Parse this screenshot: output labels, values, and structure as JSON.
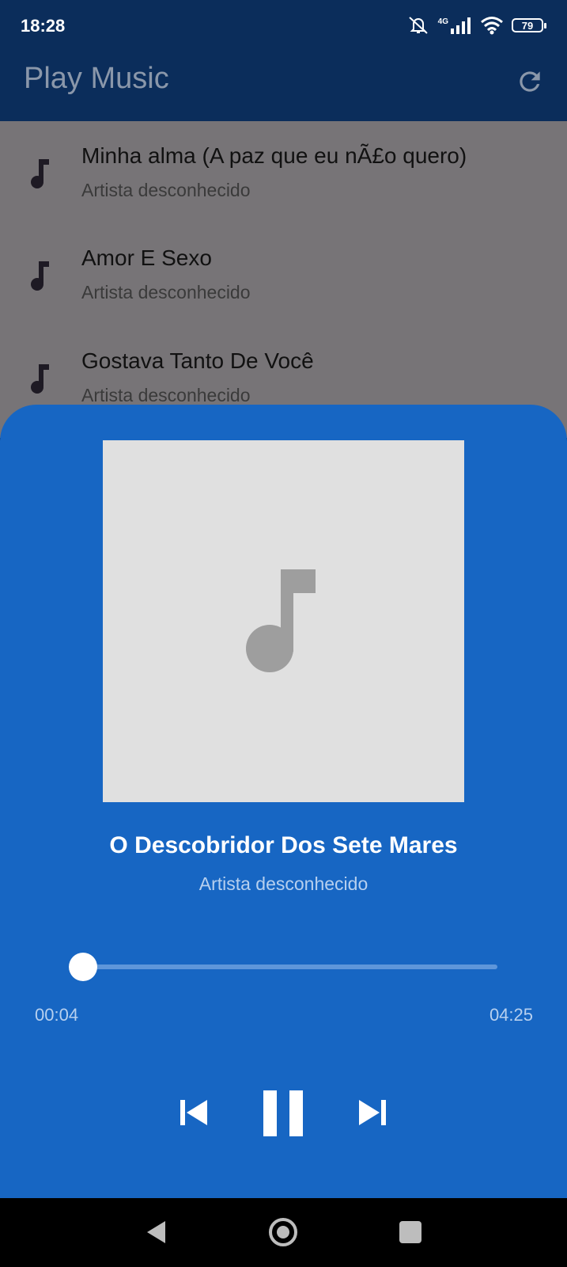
{
  "status_bar": {
    "time": "18:28",
    "network": "4G",
    "battery": "79",
    "icons": [
      "mute-icon",
      "signal-icon",
      "wifi-icon",
      "battery-icon"
    ]
  },
  "app_bar": {
    "title": "Play Music",
    "refresh_icon": "refresh-icon"
  },
  "songs": [
    {
      "title": "Minha alma (A paz que eu nÃ£o quero)",
      "artist": "Artista desconhecido"
    },
    {
      "title": "Amor E Sexo",
      "artist": "Artista desconhecido"
    },
    {
      "title": "Gostava Tanto De Você",
      "artist": "Artista desconhecido"
    }
  ],
  "player": {
    "title": "O Descobridor Dos Sete Mares",
    "artist": "Artista desconhecido",
    "current_time": "00:04",
    "total_time": "04:25",
    "progress": 0.016,
    "controls": [
      "skip-previous-icon",
      "pause-icon",
      "skip-next-icon"
    ]
  },
  "colors": {
    "app_bar_bg": "#0b2d5b",
    "list_overlay_bg": "#777477",
    "player_bg": "#1766c3",
    "album_art_bg": "#e0e0e0"
  }
}
